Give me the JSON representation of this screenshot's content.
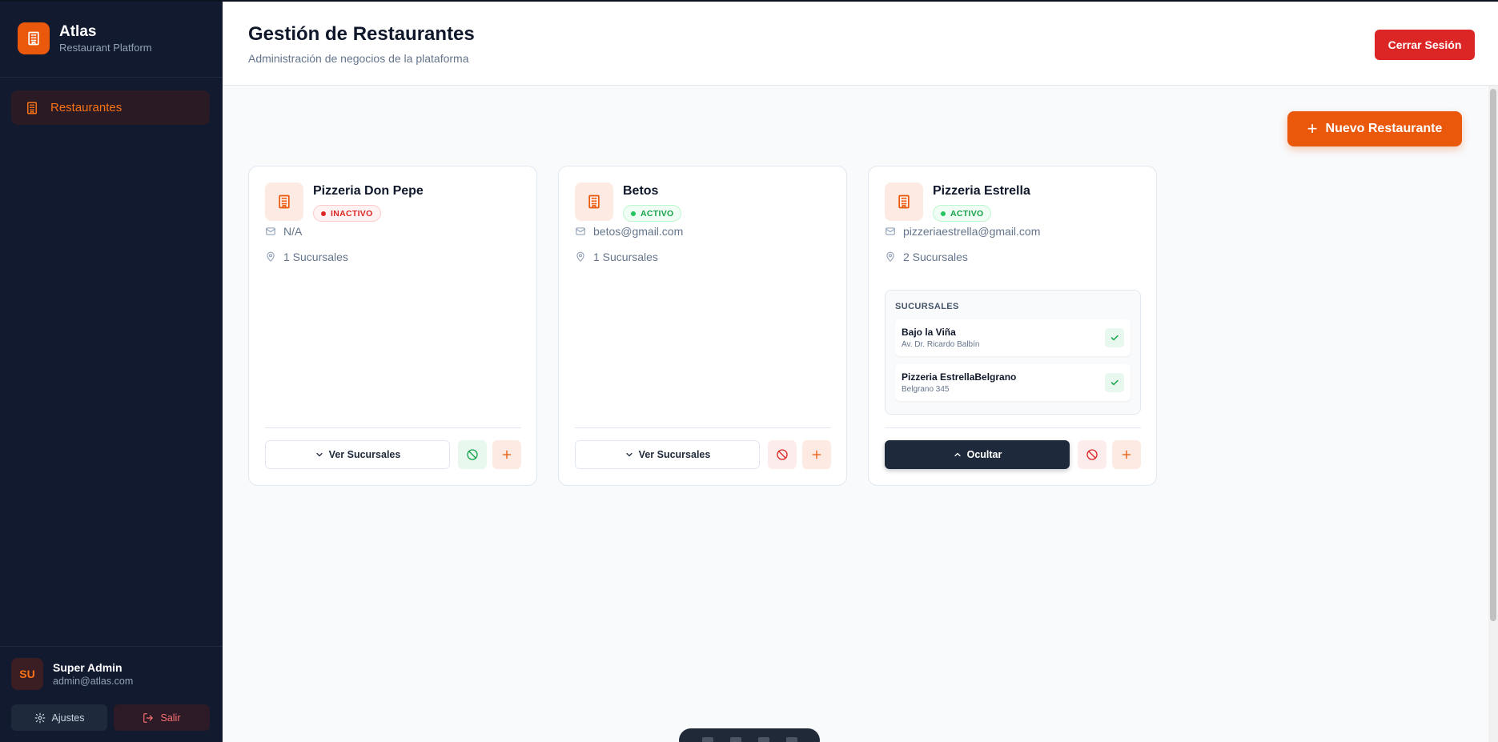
{
  "brand": {
    "name": "Atlas",
    "subtitle": "Restaurant Platform"
  },
  "sidebar": {
    "items": [
      {
        "label": "Restaurantes",
        "icon": "building-icon",
        "active": true
      }
    ]
  },
  "user": {
    "initials": "SU",
    "name": "Super Admin",
    "email": "admin@atlas.com"
  },
  "sidebar_footer": {
    "settings_label": "Ajustes",
    "logout_label": "Salir"
  },
  "header": {
    "title": "Gestión de Restaurantes",
    "subtitle": "Administración de negocios de la plataforma",
    "logout_label": "Cerrar Sesión"
  },
  "main": {
    "new_button_label": "Nuevo Restaurante",
    "restaurants": [
      {
        "name": "Pizzeria Don Pepe",
        "status": "INACTIVO",
        "email": "N/A",
        "branches_count": "1 Sucursales",
        "toggle_label": "Ver Sucursales"
      },
      {
        "name": "Betos",
        "status": "ACTIVO",
        "email": "betos@gmail.com",
        "branches_count": "1 Sucursales",
        "toggle_label": "Ver Sucursales"
      },
      {
        "name": "Pizzeria Estrella",
        "status": "ACTIVO",
        "email": "pizzeriaestrella@gmail.com",
        "branches_count": "2 Sucursales",
        "toggle_label": "Ocultar",
        "branches_title": "SUCURSALES",
        "branches": [
          {
            "name": "Bajo la Viña",
            "address": "Av. Dr. Ricardo Balbín"
          },
          {
            "name": "Pizzeria EstrellaBelgrano",
            "address": "Belgrano 345"
          }
        ]
      }
    ]
  },
  "colors": {
    "accent": "#ea580c",
    "sidebar_bg": "#111a2e",
    "danger": "#dc2626",
    "success": "#16a34a",
    "dark_button": "#1e293b"
  }
}
